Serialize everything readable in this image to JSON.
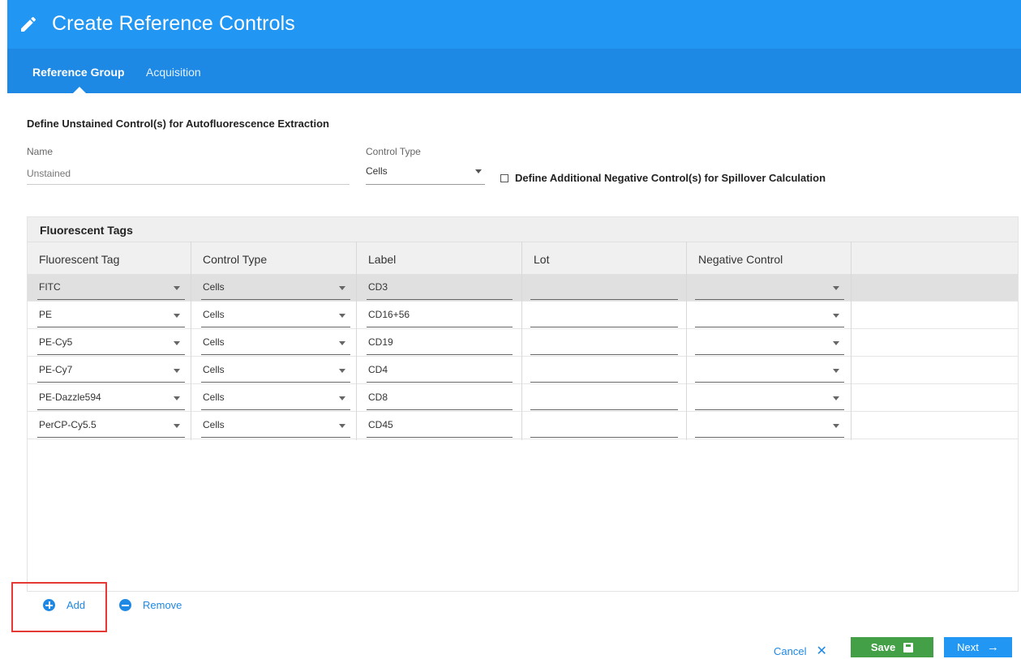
{
  "header": {
    "title": "Create Reference Controls"
  },
  "tabs": [
    {
      "label": "Reference Group",
      "active": true
    },
    {
      "label": "Acquisition",
      "active": false
    }
  ],
  "unstained": {
    "section_title": "Define Unstained Control(s) for Autofluorescence Extraction",
    "name_label": "Name",
    "name_placeholder": "Unstained",
    "control_type_label": "Control Type",
    "control_type_value": "Cells",
    "additional_checkbox_label": "Define Additional Negative Control(s) for Spillover Calculation",
    "additional_checked": false
  },
  "tags": {
    "title": "Fluorescent Tags",
    "columns": [
      "Fluorescent Tag",
      "Control Type",
      "Label",
      "Lot",
      "Negative Control"
    ],
    "rows": [
      {
        "tag": "FITC",
        "control_type": "Cells",
        "label": "CD3",
        "lot": "",
        "negative_control": "",
        "selected": true
      },
      {
        "tag": "PE",
        "control_type": "Cells",
        "label": "CD16+56",
        "lot": "",
        "negative_control": "",
        "selected": false
      },
      {
        "tag": "PE-Cy5",
        "control_type": "Cells",
        "label": "CD19",
        "lot": "",
        "negative_control": "",
        "selected": false
      },
      {
        "tag": "PE-Cy7",
        "control_type": "Cells",
        "label": "CD4",
        "lot": "",
        "negative_control": "",
        "selected": false
      },
      {
        "tag": "PE-Dazzle594",
        "control_type": "Cells",
        "label": "CD8",
        "lot": "",
        "negative_control": "",
        "selected": false
      },
      {
        "tag": "PerCP-Cy5.5",
        "control_type": "Cells",
        "label": "CD45",
        "lot": "",
        "negative_control": "",
        "selected": false
      }
    ]
  },
  "actions": {
    "add_label": "Add",
    "remove_label": "Remove",
    "cancel_label": "Cancel",
    "save_label": "Save",
    "next_label": "Next"
  },
  "colors": {
    "header_blue": "#2196f3",
    "tabbar_blue": "#1e88e5",
    "save_green": "#43a047",
    "highlight_red": "#e53935"
  }
}
